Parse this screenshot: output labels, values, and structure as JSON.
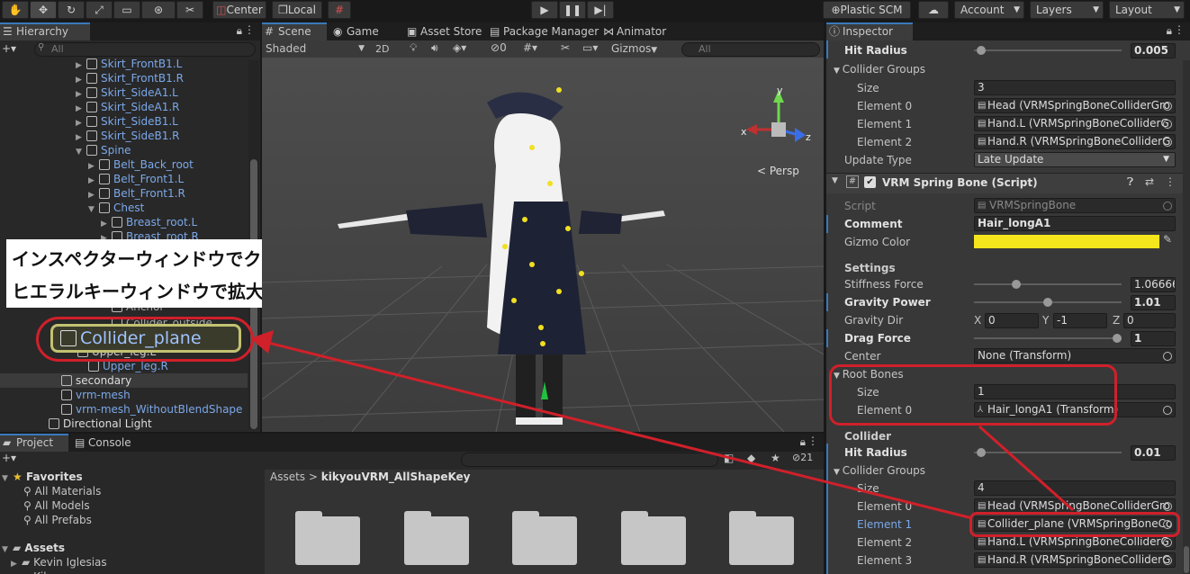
{
  "toolbar": {
    "pivot": "Center",
    "space": "Local",
    "plastic": "Plastic SCM",
    "account": "Account",
    "layers": "Layers",
    "layout": "Layout"
  },
  "hierarchy": {
    "tab": "Hierarchy",
    "search_placeholder": "All",
    "rows": [
      {
        "label": "Skirt_FrontB1.L"
      },
      {
        "label": "Skirt_FrontB1.R"
      },
      {
        "label": "Skirt_SideA1.L"
      },
      {
        "label": "Skirt_SideA1.R"
      },
      {
        "label": "Skirt_SideB1.L"
      },
      {
        "label": "Skirt_SideB1.R"
      },
      {
        "label": "Spine"
      },
      {
        "label": "Belt_Back_root"
      },
      {
        "label": "Belt_Front1.L"
      },
      {
        "label": "Belt_Front1.R"
      },
      {
        "label": "Chest"
      },
      {
        "label": "Breast_root.L"
      },
      {
        "label": "Breast_root.R"
      }
    ],
    "anchor": "Anchor",
    "collider_outside": "Collider_outside",
    "collider_plane": "Collider_plane",
    "upper_leg_l": "Upper_leg.L",
    "upper_leg_r": "Upper_leg.R",
    "secondary": "secondary",
    "vrm_mesh": "vrm-mesh",
    "vrm_mesh_noblend": "vrm-mesh_WithoutBlendShape",
    "directional_light": "Directional Light"
  },
  "annotation": {
    "line1": "インスペクターウィンドウでクリックすると",
    "line2": "ヒエラルキーウィンドウで拡大表示して教えてくれる"
  },
  "scene": {
    "tabs": [
      "Scene",
      "Game",
      "Asset Store",
      "Package Manager",
      "Animator"
    ],
    "shading": "Shaded",
    "mode2d": "2D",
    "hidden_count": "0",
    "gizmos": "Gizmos",
    "search_placeholder": "All",
    "persp": "< Persp",
    "axis_x": "x",
    "axis_y": "y",
    "axis_z": "z"
  },
  "project": {
    "tab_project": "Project",
    "tab_console": "Console",
    "favorites": "Favorites",
    "fav_items": [
      "All Materials",
      "All Models",
      "All Prefabs"
    ],
    "assets": "Assets",
    "asset_items": [
      "Kevin Iglesias",
      "Kikyo"
    ],
    "breadcrumb_root": "Assets",
    "breadcrumb_sep": ">",
    "breadcrumb_leaf": "kikyouVRM_AllShapeKey",
    "count": "21"
  },
  "inspector": {
    "tab": "Inspector",
    "collider_header_top": "Collider",
    "hit_radius_label": "Hit Radius",
    "hit_radius_value": "0.005",
    "hit_radius_fraction": 0.02,
    "collider_groups_label": "Collider Groups",
    "size_label": "Size",
    "groups_size": "3",
    "groups": [
      {
        "label": "Element 0",
        "value": "Head (VRMSpringBoneColliderGro"
      },
      {
        "label": "Element 1",
        "value": "Hand.L (VRMSpringBoneColliderG"
      },
      {
        "label": "Element 2",
        "value": "Hand.R (VRMSpringBoneColliderG"
      }
    ],
    "update_type_label": "Update Type",
    "update_type_value": "Late Update",
    "component_title": "VRM Spring Bone (Script)",
    "script_label": "Script",
    "script_value": "VRMSpringBone",
    "comment_label": "Comment",
    "comment_value": "Hair_longA1",
    "gizmo_color_label": "Gizmo Color",
    "gizmo_color": "#f4e51c",
    "settings_label": "Settings",
    "stiffness_label": "Stiffness Force",
    "stiffness_value": "1.06666",
    "stiffness_fraction": 0.27,
    "gravity_power_label": "Gravity Power",
    "gravity_power_value": "1.01",
    "gravity_power_fraction": 0.5,
    "gravity_dir_label": "Gravity Dir",
    "gravity_dir": {
      "x_label": "X",
      "x": "0",
      "y_label": "Y",
      "y": "-1",
      "z_label": "Z",
      "z": "0"
    },
    "drag_force_label": "Drag Force",
    "drag_force_value": "1",
    "drag_force_fraction": 1.0,
    "center_label": "Center",
    "center_value": "None (Transform)",
    "root_bones_label": "Root Bones",
    "root_bones_size": "1",
    "root_bones_element_label": "Element 0",
    "root_bones_element_value": "Hair_longA1 (Transform)",
    "collider_header": "Collider",
    "hit_radius2_value": "0.01",
    "hit_radius2_fraction": 0.02,
    "groups2_size": "4",
    "groups2": [
      {
        "label": "Element 0",
        "value": "Head (VRMSpringBoneColliderGro"
      },
      {
        "label": "Element 1",
        "value": "Collider_plane (VRMSpringBoneCo"
      },
      {
        "label": "Element 2",
        "value": "Hand.L (VRMSpringBoneColliderG"
      },
      {
        "label": "Element 3",
        "value": "Hand.R (VRMSpringBoneColliderG"
      }
    ]
  },
  "colors": {
    "accent": "#3a79bb",
    "highlight": "#d0202a",
    "selection_text": "#7ba8e8"
  }
}
